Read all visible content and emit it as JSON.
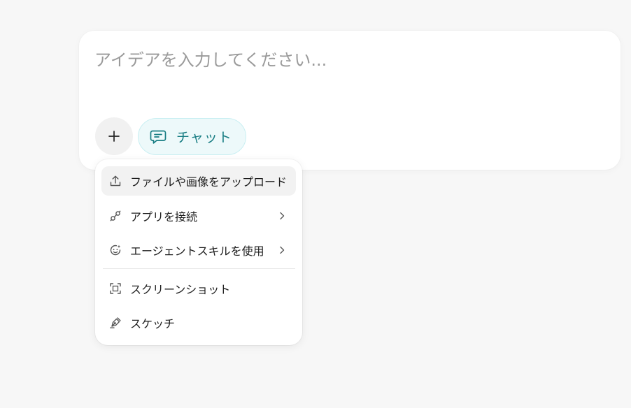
{
  "composer": {
    "placeholder": "アイデアを入力してください...",
    "input_value": "",
    "add_button_icon": "plus-icon",
    "mode_pill": {
      "label": "チャット",
      "icon": "chat-bubble-icon",
      "accent_color": "#167c82"
    }
  },
  "menu": {
    "items": [
      {
        "label": "ファイルや画像をアップロード",
        "icon": "upload-icon",
        "has_submenu": false,
        "highlighted": true
      },
      {
        "label": "アプリを接続",
        "icon": "plug-icon",
        "has_submenu": true,
        "highlighted": false
      },
      {
        "label": "エージェントスキルを使用",
        "icon": "skill-face-icon",
        "has_submenu": true,
        "highlighted": false
      },
      {
        "label": "スクリーンショット",
        "icon": "screenshot-icon",
        "has_submenu": false,
        "highlighted": false
      },
      {
        "label": "スケッチ",
        "icon": "pen-icon",
        "has_submenu": false,
        "highlighted": false
      }
    ]
  }
}
